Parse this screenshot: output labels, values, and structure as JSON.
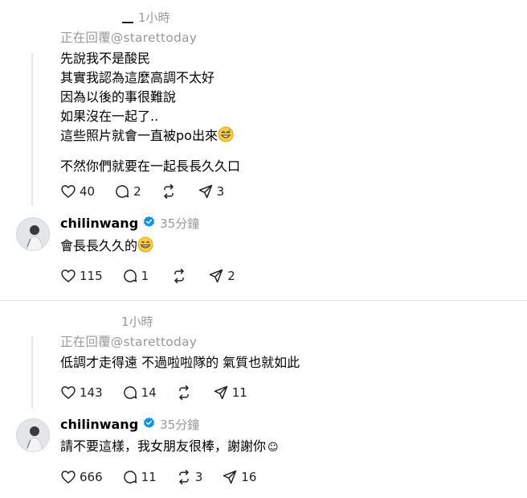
{
  "thread1": {
    "comment": {
      "time": "1小時",
      "reply_to": "正在回覆@starettoday",
      "lines": [
        "先說我不是酸民",
        "其實我認為這麼高調不太好",
        "因為以後的事很難說",
        "如果沒在一起了..",
        "這些照片就會一直被po出來"
      ],
      "last_line": "不然你們就要在一起長長久久",
      "last_line_tail": "口",
      "likes": "40",
      "replies": "2",
      "shares": "3"
    },
    "reply": {
      "username": "chilinwang",
      "time": "35分鐘",
      "text": "會長長久久的",
      "likes": "115",
      "replies": "1",
      "shares": "2"
    }
  },
  "thread2": {
    "comment": {
      "time": "1小時",
      "reply_to": "正在回覆@starettoday",
      "text": "低調才走得遠 不過啦啦隊的 氣質也就如此",
      "likes": "143",
      "replies": "14",
      "shares": "11"
    },
    "reply": {
      "username": "chilinwang",
      "time": "35分鐘",
      "text": "請不要這樣，我女朋友很棒，謝謝你",
      "text_tail": "☺",
      "likes": "666",
      "replies": "11",
      "reposts": "3",
      "shares": "16"
    }
  },
  "colors": {
    "verified": "#0095f6",
    "muted": "#999999",
    "divider": "#e6e6e6"
  },
  "icons": [
    "heart-icon",
    "comment-icon",
    "repost-icon",
    "share-icon",
    "verified-badge-icon",
    "grinning-sweat-emoji",
    "grinning-emoji",
    "smiley-icon"
  ]
}
